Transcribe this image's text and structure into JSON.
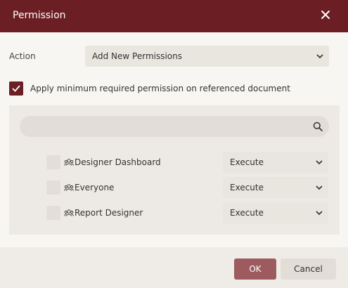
{
  "dialog": {
    "title": "Permission",
    "close_icon": "close-icon"
  },
  "action": {
    "label": "Action",
    "selected": "Add New Permissions"
  },
  "apply": {
    "checked": true,
    "label": "Apply minimum required permission on referenced document"
  },
  "search": {
    "value": "",
    "placeholder": "",
    "icon": "search-icon"
  },
  "rows": [
    {
      "name": "Designer Dashboard",
      "checked": false,
      "permission": "Execute",
      "icon": "group-icon"
    },
    {
      "name": "Everyone",
      "checked": false,
      "permission": "Execute",
      "icon": "group-icon"
    },
    {
      "name": "Report Designer",
      "checked": false,
      "permission": "Execute",
      "icon": "group-icon"
    }
  ],
  "footer": {
    "ok_label": "OK",
    "cancel_label": "Cancel"
  },
  "colors": {
    "header": "#6b1f24",
    "checkbox_checked": "#6b1f24",
    "ok_button": "#9d5a5f"
  }
}
